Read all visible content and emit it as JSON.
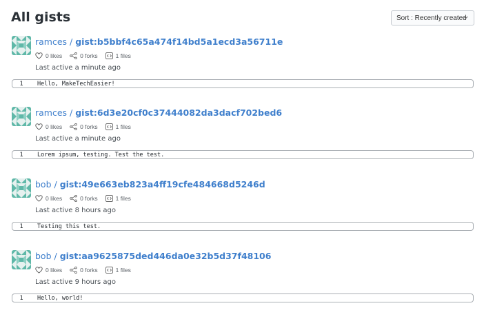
{
  "page": {
    "title": "All gists",
    "sort_label": "Sort : Recently created"
  },
  "gists": [
    {
      "owner": "ramces",
      "gist_id": "gist:b5bbf4c65a474f14bd5a1ecd3a56711e",
      "likes": "0 likes",
      "forks": "0 forks",
      "files": "1 files",
      "last_active": "Last active a minute ago",
      "line_number": "1",
      "code": "Hello, MakeTechEasier!"
    },
    {
      "owner": "ramces",
      "gist_id": "gist:6d3e20cf0c37444082da3dacf702bed6",
      "likes": "0 likes",
      "forks": "0 forks",
      "files": "1 files",
      "last_active": "Last active a minute ago",
      "line_number": "1",
      "code": "Lorem ipsum, testing. Test the test."
    },
    {
      "owner": "bob",
      "gist_id": "gist:49e663eb823a4ff19cfe484668d5246d",
      "likes": "0 likes",
      "forks": "0 forks",
      "files": "1 files",
      "last_active": "Last active 8 hours ago",
      "line_number": "1",
      "code": "Testing this test."
    },
    {
      "owner": "bob",
      "gist_id": "gist:aa9625875ded446da0e32b5d37f48106",
      "likes": "0 likes",
      "forks": "0 forks",
      "files": "1 files",
      "last_active": "Last active 9 hours ago",
      "line_number": "1",
      "code": "Hello, world!"
    }
  ],
  "colors": {
    "link": "#3f7fcc",
    "avatar_teal": "#5fb8a8"
  },
  "icons": {
    "likes": "heart-icon",
    "forks": "share-fork-icon",
    "files": "code-file-icon",
    "sort": "chevron-down-icon",
    "avatar": "identicon-avatar"
  }
}
